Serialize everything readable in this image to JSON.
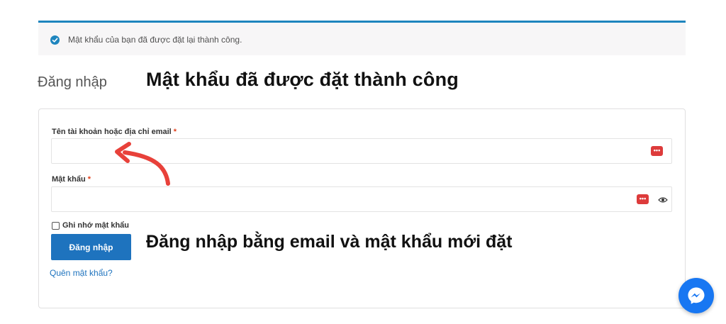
{
  "notice": {
    "message": "Mật khẩu của bạn đã được đặt lại thành công.",
    "icon": "check-circle-icon",
    "accent_color": "#1e85be"
  },
  "login": {
    "heading": "Đăng nhập",
    "username_label": "Tên tài khoản hoặc địa chỉ email",
    "username_value": "",
    "password_label": "Mật khẩu",
    "password_value": "",
    "required_mark": "*",
    "remember_label": "Ghi nhớ mật khẩu",
    "submit_label": "Đăng nhập",
    "lost_password_label": "Quên mật khẩu?"
  },
  "annotations": {
    "top": "Mật khẩu đã được đặt thành công",
    "bottom": "Đăng nhập bằng email và mật khẩu mới đặt",
    "arrow_color": "#e8413a"
  },
  "icons": {
    "password_manager": "password-manager-icon",
    "show_password": "eye-icon",
    "chat": "messenger-icon"
  }
}
